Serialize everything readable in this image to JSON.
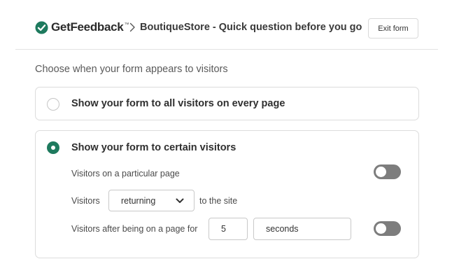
{
  "header": {
    "brand": "GetFeedback",
    "brand_tm": "™",
    "breadcrumb_separator_icon": "chevron-right-icon",
    "form_title": "BoutiqueStore - Quick question before you go",
    "exit_label": "Exit form"
  },
  "main": {
    "prompt": "Choose when your form appears to visitors",
    "options": [
      {
        "label": "Show your form to all visitors on every page",
        "selected": false
      },
      {
        "label": "Show your form to certain visitors",
        "selected": true
      }
    ],
    "conditions": {
      "particular_page_label": "Visitors on a particular page",
      "particular_page_enabled": false,
      "visitors_prefix": "Visitors",
      "visitor_type_value": "returning",
      "visitors_suffix": "to the site",
      "time_on_page_label": "Visitors after being on a page for",
      "time_amount": "5",
      "time_unit": "seconds",
      "time_on_page_enabled": false
    }
  },
  "colors": {
    "accent": "#1e7a5e",
    "toggle_off": "#7d7d7d",
    "border": "#dcdcdc"
  }
}
